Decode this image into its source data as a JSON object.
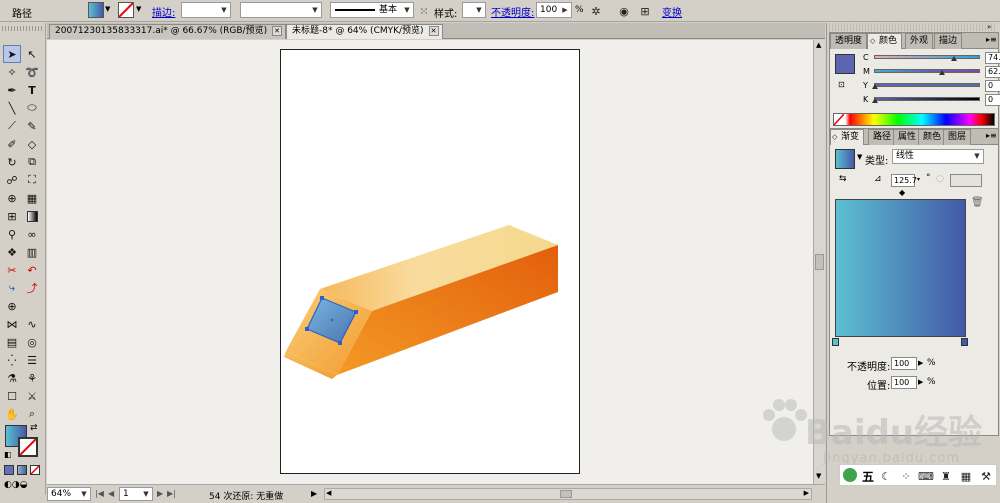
{
  "control_bar": {
    "object_type": "路径",
    "stroke_label": "描边:",
    "stroke_weight": "",
    "style_preset": "",
    "brush_label": "基本",
    "style_label": "样式:",
    "opacity_label": "不透明度:",
    "opacity_value": "100",
    "percent": "%",
    "transform_label": "变换"
  },
  "doc_tabs": [
    {
      "label": "20071230135833317.ai* @ 66.67% (RGB/预览)",
      "active": false
    },
    {
      "label": "未标题-8* @ 64% (CMYK/预览)",
      "active": true
    }
  ],
  "status_bar": {
    "zoom": "64%",
    "page": "1",
    "undo_status": "54 次还原: 无重做"
  },
  "color_panel": {
    "tabs": [
      "透明度",
      "颜色",
      "外观",
      "描边"
    ],
    "active_tab": "颜色",
    "channels": [
      {
        "label": "C",
        "value": "74.22",
        "pos": 0.742
      },
      {
        "label": "M",
        "value": "62.89",
        "pos": 0.629
      },
      {
        "label": "Y",
        "value": "0",
        "pos": 0
      },
      {
        "label": "K",
        "value": "0",
        "pos": 0
      }
    ],
    "fill_color": "#5c66b0"
  },
  "gradient_panel": {
    "tabs": [
      "渐变",
      "路径",
      "属性",
      "颜色",
      "图层"
    ],
    "active_tab": "渐变",
    "type_label": "类型:",
    "type_value": "线性",
    "angle_value": "125.7",
    "degree": "°",
    "opacity_label": "不透明度:",
    "opacity_value": "100",
    "location_label": "位置:",
    "location_value": "100",
    "percent": "%",
    "start_color": "#5bc0d0",
    "end_color": "#4459a8"
  },
  "watermark": {
    "text": "Baidu经验",
    "url": "jingyan.baidu.com"
  },
  "bottom_panel": {
    "label": "五"
  }
}
